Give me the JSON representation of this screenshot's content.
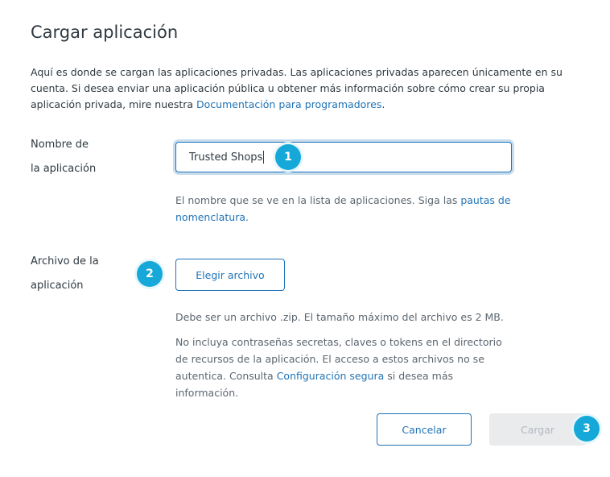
{
  "dialog": {
    "title": "Cargar aplicación",
    "intro_text": "Aquí es donde se cargan las aplicaciones privadas. Las aplicaciones privadas aparecen únicamente en su cuenta. Si desea enviar una aplicación pública u obtener más información sobre cómo crear su propia aplicación privada, mire nuestra ",
    "intro_link": "Documentación para programadores",
    "intro_end": "."
  },
  "name_field": {
    "label_line1": "Nombre de",
    "label_line2": "la aplicación",
    "value": "Trusted Shops",
    "hint_text": "El nombre que se ve en la lista de aplicaciones. Siga las ",
    "hint_link": "pautas de nomenclatura",
    "hint_end": "."
  },
  "file_field": {
    "label_line1": "Archivo de la",
    "label_line2": "aplicación",
    "button_label": "Elegir archivo",
    "hint_size": "Debe ser un archivo .zip. El tamaño máximo del archivo es 2 MB.",
    "hint_security": "No incluya contraseñas secretas, claves o tokens en el directorio de recursos de la aplicación. El acceso a estos archivos no se autentica. Consulta ",
    "hint_security_link": "Configuración segura",
    "hint_security_end": " si desea más información."
  },
  "footer": {
    "cancel_label": "Cancelar",
    "submit_label": "Cargar"
  },
  "callouts": {
    "step1": "1",
    "step2": "2",
    "step3": "3",
    "color": "#15a8d8"
  },
  "colors": {
    "accent": "#1f73b7",
    "text": "#2f3941",
    "muted_text": "#5b6670",
    "disabled_bg": "#e9ebed",
    "disabled_text": "#b3b9bf"
  }
}
